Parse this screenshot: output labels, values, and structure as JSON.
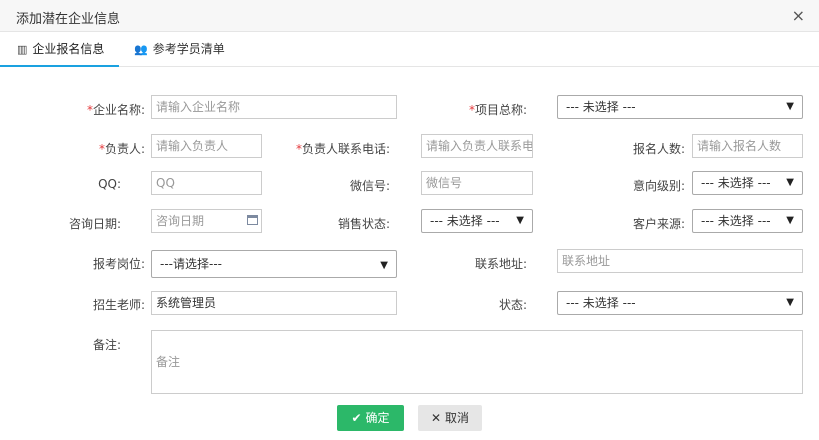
{
  "window": {
    "title": "添加潜在企业信息",
    "close_icon": "×"
  },
  "tabs": [
    {
      "label": "企业报名信息",
      "icon": "list-icon",
      "active": true
    },
    {
      "label": "参考学员清单",
      "icon": "users-icon",
      "active": false
    }
  ],
  "form": {
    "required_mark": "*",
    "company_name": {
      "label": "企业名称:",
      "placeholder": "请输入企业名称"
    },
    "project": {
      "label": "项目总称:",
      "value": "--- 未选择 ---"
    },
    "contact": {
      "label": "负责人:",
      "placeholder": "请输入负责人"
    },
    "contact_phone": {
      "label": "负责人联系电话:",
      "placeholder": "请输入负责人联系电"
    },
    "enroll_count": {
      "label": "报名人数:",
      "placeholder": "请输入报名人数"
    },
    "qq": {
      "label": "QQ:",
      "placeholder": "QQ"
    },
    "wechat": {
      "label": "微信号:",
      "placeholder": "微信号"
    },
    "intent_level": {
      "label": "意向级别:",
      "value": "--- 未选择 ---"
    },
    "consult_date": {
      "label": "咨询日期:",
      "placeholder": "咨询日期"
    },
    "sales_status": {
      "label": "销售状态:",
      "value": "--- 未选择 ---"
    },
    "customer_source": {
      "label": "客户来源:",
      "value": "--- 未选择 ---"
    },
    "exam_position": {
      "label": "报考岗位:",
      "value": "---请选择---"
    },
    "address": {
      "label": "联系地址:",
      "placeholder": "联系地址"
    },
    "teacher": {
      "label": "招生老师:",
      "value": "系统管理员"
    },
    "status": {
      "label": "状态:",
      "value": "--- 未选择 ---"
    },
    "remark": {
      "label": "备注:",
      "placeholder": "备注"
    }
  },
  "buttons": {
    "ok": "确定",
    "cancel": "取消",
    "ok_icon": "✔",
    "cancel_icon": "✕"
  },
  "arrow": "▼"
}
